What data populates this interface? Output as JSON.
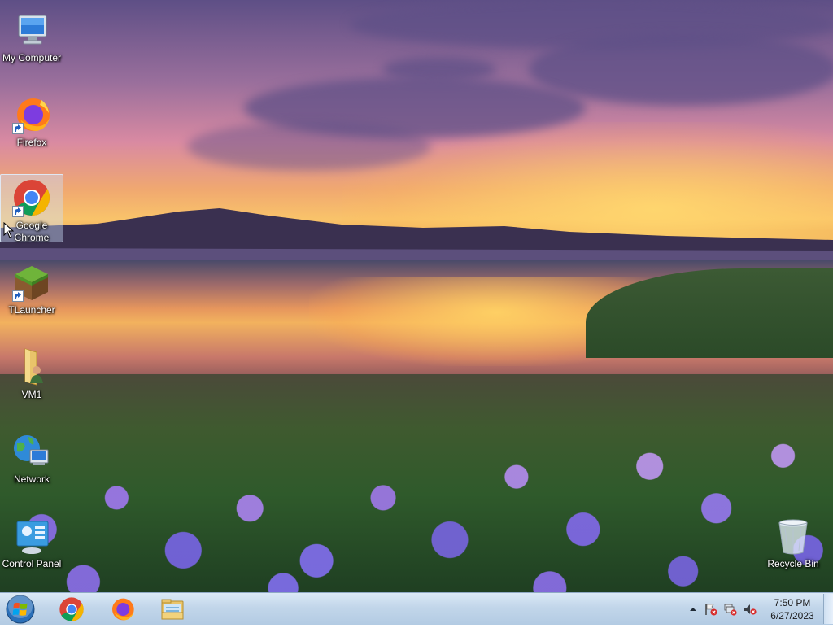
{
  "desktop": {
    "icons": [
      {
        "label": "My Computer",
        "icon": "computer-icon",
        "shortcut": false
      },
      {
        "label": "Firefox",
        "icon": "firefox-icon",
        "shortcut": true
      },
      {
        "label": "Google Chrome",
        "icon": "chrome-icon",
        "shortcut": true,
        "selected": true
      },
      {
        "label": "TLauncher",
        "icon": "tlauncher-icon",
        "shortcut": true
      },
      {
        "label": "VM1",
        "icon": "folder-user-icon",
        "shortcut": false
      },
      {
        "label": "Network",
        "icon": "network-icon",
        "shortcut": false
      },
      {
        "label": "Control Panel",
        "icon": "control-panel-icon",
        "shortcut": false
      },
      {
        "label": "Recycle Bin",
        "icon": "recycle-bin-icon",
        "shortcut": false
      }
    ]
  },
  "taskbar": {
    "start": {
      "icon": "windows-start-icon"
    },
    "pinned": [
      {
        "name": "Google Chrome",
        "icon": "chrome-icon"
      },
      {
        "name": "Firefox",
        "icon": "firefox-icon"
      },
      {
        "name": "Windows Explorer",
        "icon": "explorer-folder-icon"
      }
    ],
    "tray": {
      "icons": [
        "show-hidden-icons-arrow",
        "action-center-flag-icon",
        "network-disconnected-icon",
        "volume-muted-icon"
      ],
      "time": "7:50 PM",
      "date": "6/27/2023"
    }
  },
  "colors": {
    "taskbar_top": "#dbe9f6",
    "taskbar_bottom": "#b3cbe3",
    "selection": "#cde1fa"
  }
}
